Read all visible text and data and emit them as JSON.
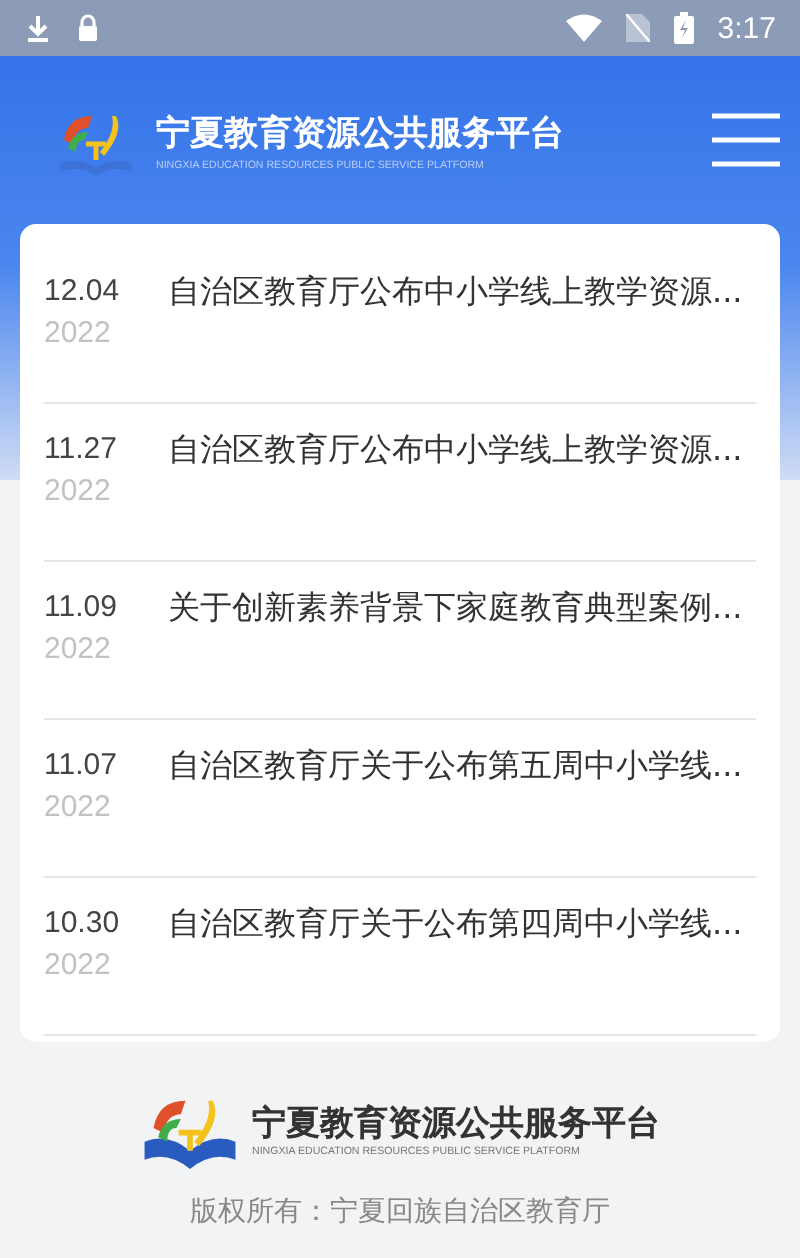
{
  "status_bar": {
    "time": "3:17"
  },
  "header": {
    "title": "宁夏教育资源公共服务平台",
    "subtitle": "NINGXIA EDUCATION RESOURCES PUBLIC SERVICE PLATFORM"
  },
  "news": [
    {
      "date": "12.04",
      "year": "2022",
      "title": "自治区教育厅公布中小学线上教学资源..."
    },
    {
      "date": "11.27",
      "year": "2022",
      "title": "自治区教育厅公布中小学线上教学资源..."
    },
    {
      "date": "11.09",
      "year": "2022",
      "title": "关于创新素养背景下家庭教育典型案例..."
    },
    {
      "date": "11.07",
      "year": "2022",
      "title": "自治区教育厅关于公布第五周中小学线..."
    },
    {
      "date": "10.30",
      "year": "2022",
      "title": "自治区教育厅关于公布第四周中小学线..."
    }
  ],
  "footer": {
    "title": "宁夏教育资源公共服务平台",
    "subtitle": "NINGXIA EDUCATION RESOURCES PUBLIC SERVICE PLATFORM",
    "copyright": "版权所有：宁夏回族自治区教育厅"
  }
}
